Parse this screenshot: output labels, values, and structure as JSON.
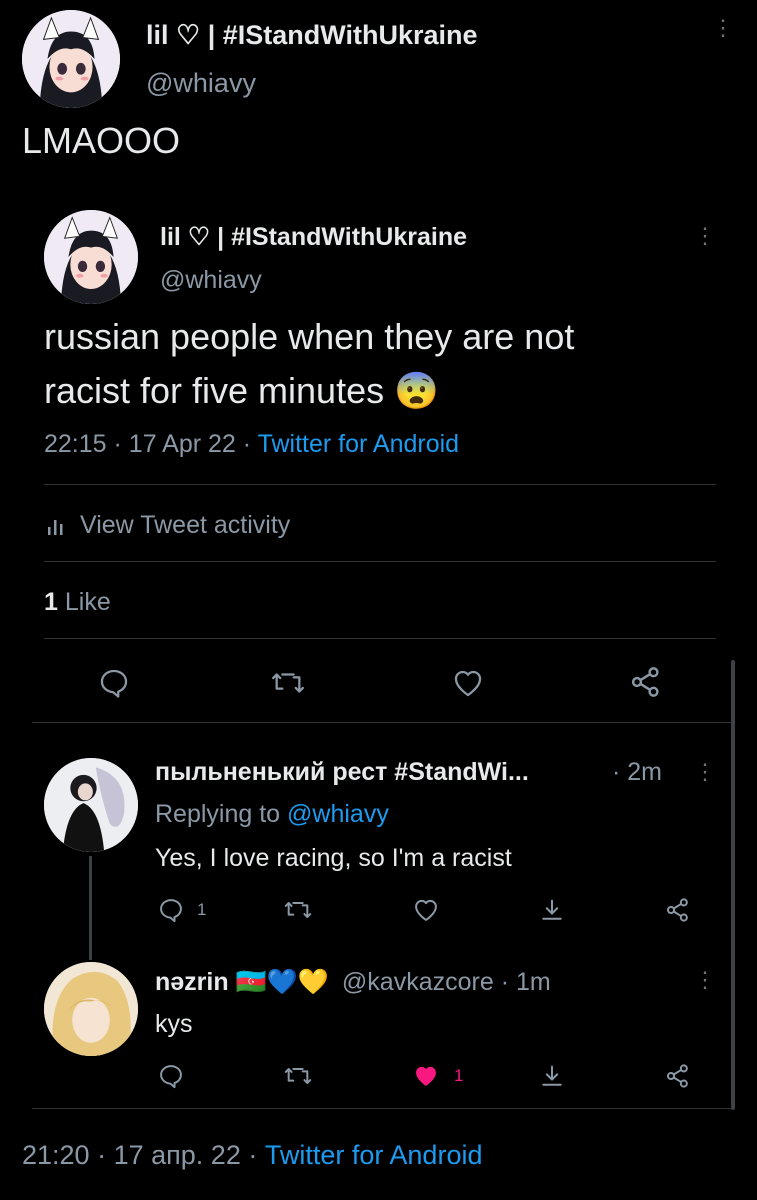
{
  "main_tweet": {
    "display_name": "lil ♡ | #IStandWithUkraine",
    "handle": "@whiavy",
    "text": "LMAOOO"
  },
  "quoted_tweet": {
    "display_name": "lil ♡ | #IStandWithUkraine",
    "handle": "@whiavy",
    "text_line1": "russian people when they are not",
    "text_line2": "racist for five minutes",
    "emoji": "😨",
    "time": "22:15",
    "date": "17 Apr 22",
    "source": "Twitter for Android",
    "separator": "·",
    "activity_label": "View Tweet activity",
    "likes_count": "1",
    "likes_label": "Like"
  },
  "reply_1": {
    "display_name": "пыльненький рест #StandWi...",
    "time": "2m",
    "replying_prefix": "Replying to",
    "replying_handle": "@whiavy",
    "text": "Yes, I love racing, so I'm a racist",
    "reply_count": "1"
  },
  "reply_2": {
    "display_name": "nəzrin",
    "emoji_flags": "🇦🇿💙💛",
    "handle": "@kavkazcore",
    "time": "1m",
    "text": "kys",
    "like_count": "1"
  },
  "footer": {
    "time": "21:20",
    "date": "17 апр. 22",
    "source": "Twitter for Android"
  },
  "colors": {
    "background": "#000000",
    "text": "#e7e9ea",
    "muted": "#8b98a5",
    "link": "#1d9bf0",
    "like_active": "#f91880",
    "divider": "#2f3336"
  }
}
